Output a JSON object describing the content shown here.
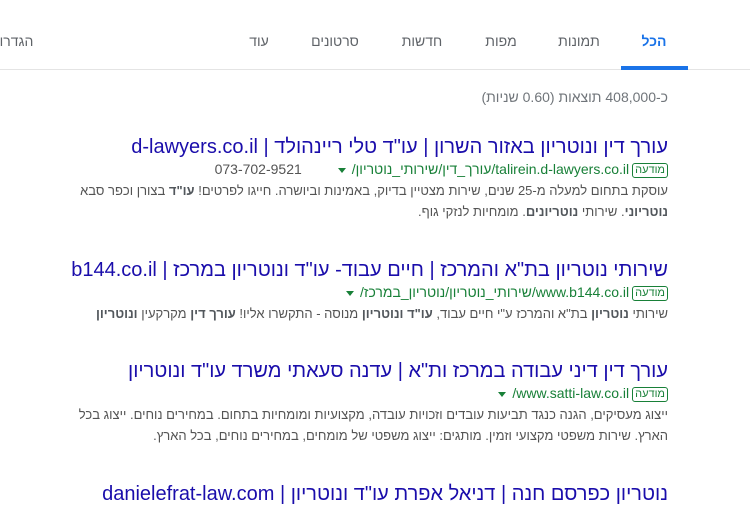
{
  "nav": {
    "tabs": [
      {
        "label": "הכל",
        "active": true
      },
      {
        "label": "תמונות"
      },
      {
        "label": "מפות"
      },
      {
        "label": "חדשות"
      },
      {
        "label": "סרטונים"
      },
      {
        "label": "עוד"
      }
    ],
    "settings_label": "הגדרות"
  },
  "stats": "כ-408,000 תוצאות (0.60 שניות)",
  "results": [
    {
      "title": "עורך דין ונוטריון באזור השרון | עו\"ד טלי ריינהולד | d-lawyers.co.il",
      "ad_label": "מודעה",
      "url": "talirein.d-lawyers.co.il/עורך_דין/שירותי_נוטריון/",
      "phone": "073-702-9521",
      "snippet": [
        [
          {
            "t": "עוסקת בתחום למעלה מ-25 שנים, שירות מצטיין בדיוק, באמינות וביושרה. חייגו לפרטים! "
          },
          {
            "t": "עו\"ד",
            "b": true
          },
          {
            "t": " בצורן וכפר סבא"
          }
        ],
        [
          {
            "t": "נוטריוני",
            "b": true
          },
          {
            "t": ". שירותי "
          },
          {
            "t": "נוטריונים",
            "b": true
          },
          {
            "t": ". מומחיות לנזקי גוף."
          }
        ]
      ]
    },
    {
      "title": "שירותי נוטריון בת\"א והמרכז | חיים עבוד- עו\"ד ונוטריון במרכז | b144.co.il",
      "ad_label": "מודעה",
      "url": "www.b144.co.il/שירותי_נוטריון/נוטריון_במרכז/",
      "snippet": [
        [
          {
            "t": "שירותי "
          },
          {
            "t": "נוטריון",
            "b": true
          },
          {
            "t": " בת\"א והמרכז ע\"י חיים עבוד, "
          },
          {
            "t": "עו\"ד ונוטריון",
            "b": true
          },
          {
            "t": " מנוסה - התקשרו אליו! "
          },
          {
            "t": "עורך דין",
            "b": true
          },
          {
            "t": " מקרקעין "
          },
          {
            "t": "ונוטריון",
            "b": true
          }
        ]
      ]
    },
    {
      "title": "עורך דין דיני עבודה במרכז ות\"א | עדנה סעאתי משרד עו\"ד ונוטריון",
      "ad_label": "מודעה",
      "url": "www.satti-law.co.il/",
      "snippet": [
        [
          {
            "t": "ייצוג מעסיקים, הגנה כנגד תביעות עובדים וזכויות עובדה, מקצועיות ומומחיות בתחום. במחירים נוחים. ייצוג בכל"
          }
        ],
        [
          {
            "t": "הארץ. שירות משפטי מקצועי וזמין. מותגים: ייצוג משפטי של מומחים, במחירים נוחים, בכל הארץ."
          }
        ]
      ]
    },
    {
      "title": "נוטריון כפרסם חנה | דניאל אפרת עו\"ד ונוטריון | danielefrat-law.com"
    }
  ]
}
